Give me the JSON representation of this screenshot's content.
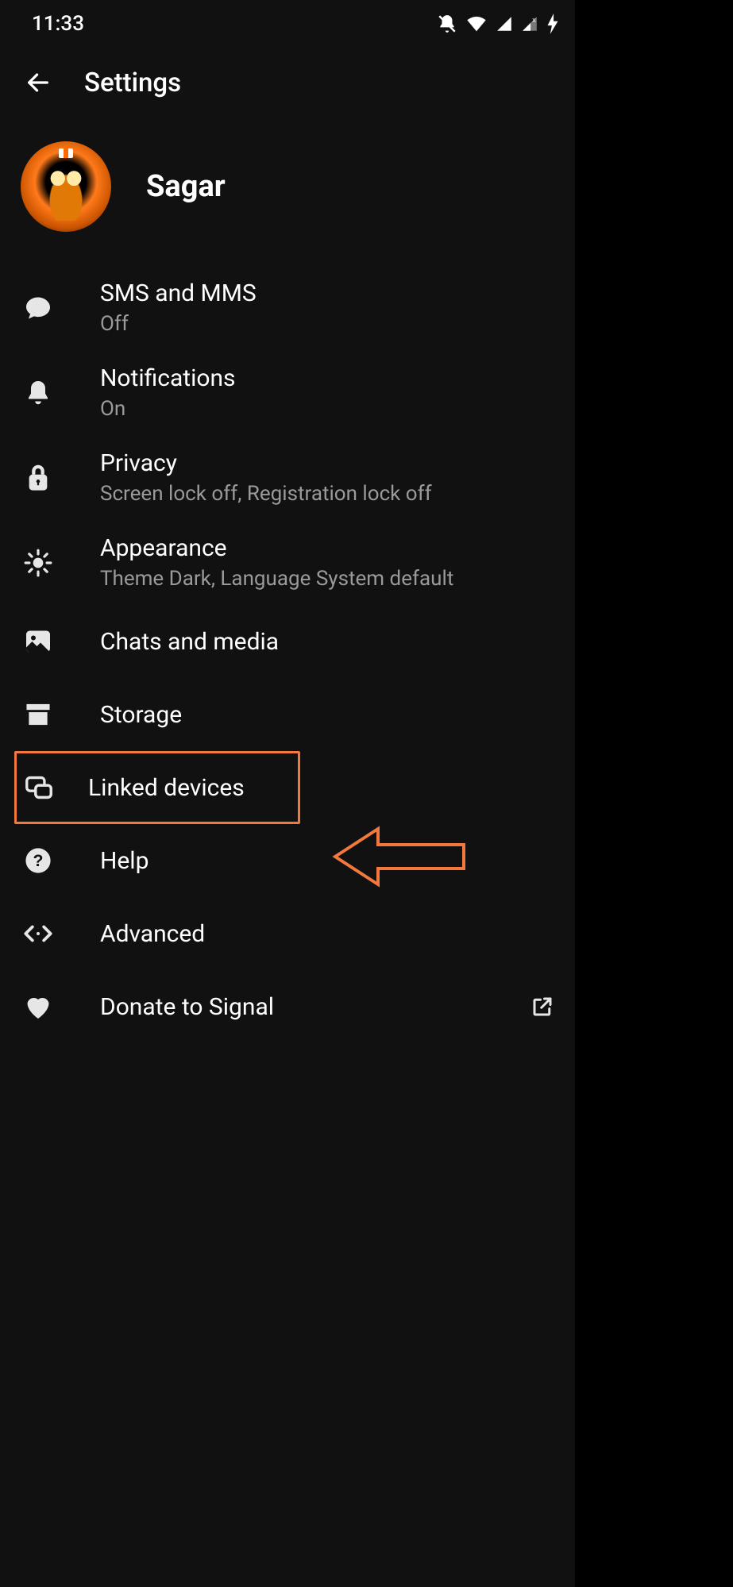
{
  "status": {
    "time": "11:33"
  },
  "header": {
    "title": "Settings"
  },
  "profile": {
    "name": "Sagar"
  },
  "items": {
    "sms": {
      "title": "SMS and MMS",
      "sub": "Off"
    },
    "notif": {
      "title": "Notifications",
      "sub": "On"
    },
    "privacy": {
      "title": "Privacy",
      "sub": "Screen lock off, Registration lock off"
    },
    "appearance": {
      "title": "Appearance",
      "sub": "Theme Dark, Language System default"
    },
    "chats": {
      "title": "Chats and media"
    },
    "storage": {
      "title": "Storage"
    },
    "linked": {
      "title": "Linked devices"
    },
    "help": {
      "title": "Help"
    },
    "advanced": {
      "title": "Advanced"
    },
    "donate": {
      "title": "Donate to Signal"
    }
  }
}
